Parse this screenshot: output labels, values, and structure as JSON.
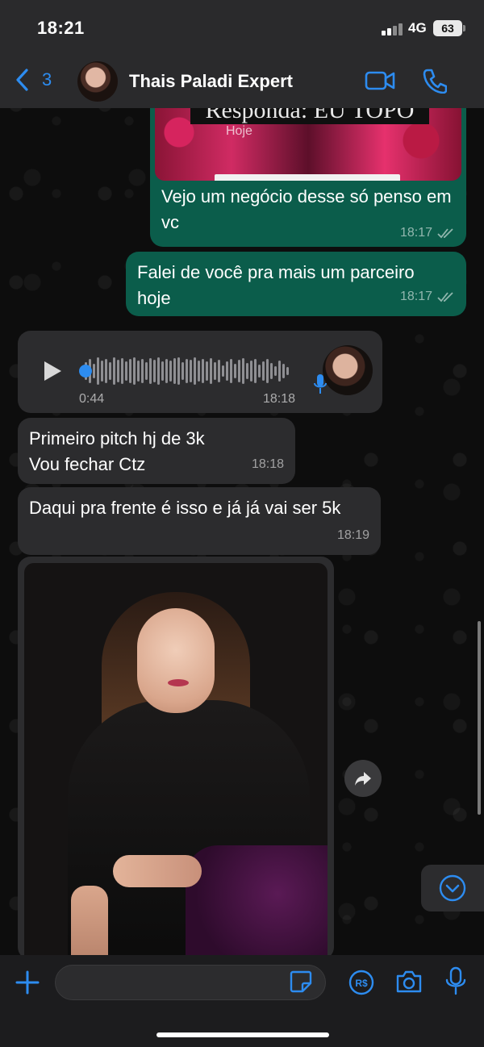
{
  "status_bar": {
    "time": "18:21",
    "network": "4G",
    "battery": "63"
  },
  "header": {
    "back_count": "3",
    "contact_name": "Thais Paladi Expert",
    "icons": [
      "chevron-left-icon",
      "video-call-icon",
      "phone-icon"
    ]
  },
  "messages": [
    {
      "type": "image",
      "direction": "outgoing",
      "image_caption_text": "Responda: EU TOPO",
      "image_label": "Hoje",
      "text": "Vejo um negócio desse só penso em vc",
      "time": "18:17",
      "status": "read"
    },
    {
      "type": "text",
      "direction": "outgoing",
      "text": "Falei de você pra mais um parceiro hoje",
      "time": "18:17",
      "status": "read"
    },
    {
      "type": "voice",
      "direction": "incoming",
      "duration": "0:44",
      "time": "18:18"
    },
    {
      "type": "text",
      "direction": "incoming",
      "text": "Primeiro pitch hj de 3k\nVou fechar Ctz",
      "time": "18:18"
    },
    {
      "type": "text",
      "direction": "incoming",
      "text": "Daqui pra frente é isso e já já vai ser 5k",
      "time": "18:19"
    },
    {
      "type": "image",
      "direction": "incoming"
    }
  ],
  "input": {
    "placeholder": "",
    "icons": [
      "plus-icon",
      "sticker-icon",
      "pix-payment-icon",
      "camera-icon",
      "microphone-icon"
    ]
  },
  "colors": {
    "accent": "#2d8cf0",
    "outgoing_bubble": "#0b5d4b",
    "incoming_bubble": "#2c2c2e",
    "header_bg": "#2a2a2c"
  }
}
